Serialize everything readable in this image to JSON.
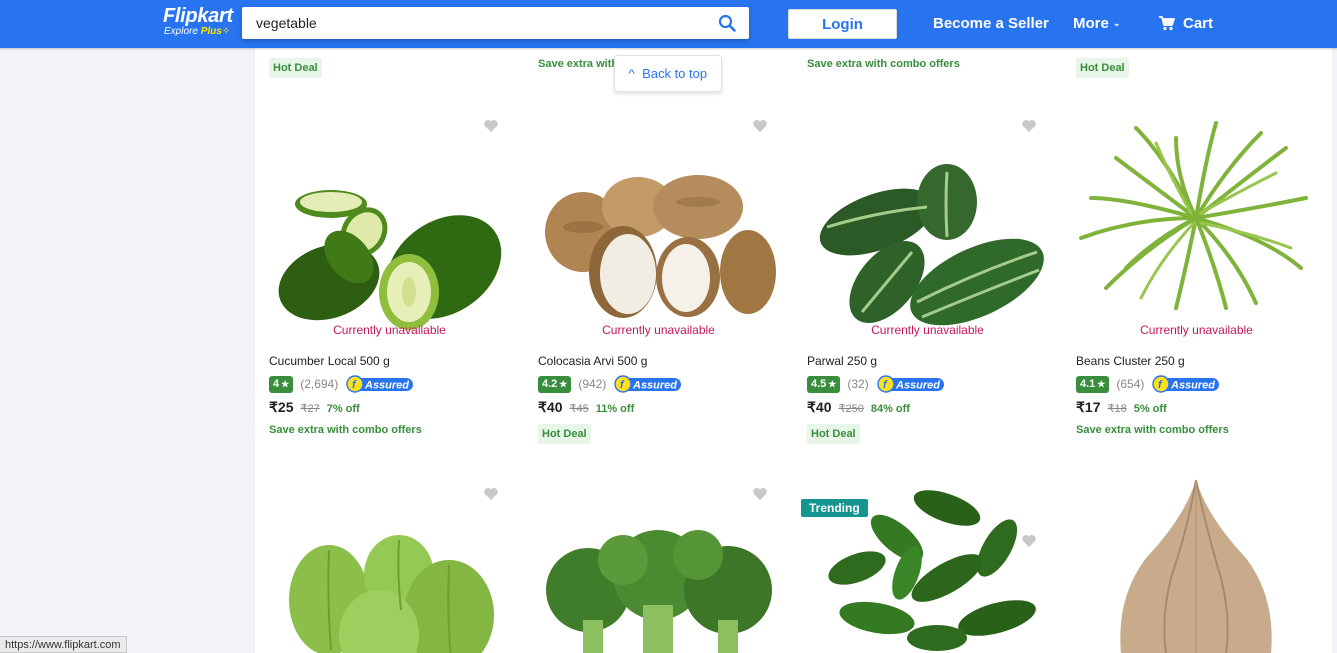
{
  "header": {
    "logo": "Flipkart",
    "logo_sub": "Explore",
    "logo_plus": "Plus",
    "search_value": "vegetable",
    "login_label": "Login",
    "become_seller_label": "Become a Seller",
    "more_label": "More",
    "cart_label": "Cart",
    "brand_color": "#2874f0"
  },
  "back_to_top_label": "Back to top",
  "previous_row": {
    "tags": [
      "Hot Deal",
      "Save extra with",
      "Save extra with combo offers",
      "Hot Deal"
    ]
  },
  "products": [
    {
      "name": "Cucumber Local 500 g",
      "status": "Currently unavailable",
      "rating": "4",
      "reviews": "(2,694)",
      "price": "₹25",
      "mrp": "₹27",
      "discount": "7% off",
      "offer": "Save extra with combo offers",
      "assured": "Assured"
    },
    {
      "name": "Colocasia Arvi 500 g",
      "status": "Currently unavailable",
      "rating": "4.2",
      "reviews": "(942)",
      "price": "₹40",
      "mrp": "₹45",
      "discount": "11% off",
      "offer": "Hot Deal",
      "assured": "Assured"
    },
    {
      "name": "Parwal 250 g",
      "status": "Currently unavailable",
      "rating": "4.5",
      "reviews": "(32)",
      "price": "₹40",
      "mrp": "₹250",
      "discount": "84% off",
      "offer": "Hot Deal",
      "assured": "Assured"
    },
    {
      "name": "Beans Cluster 250 g",
      "status": "Currently unavailable",
      "rating": "4.1",
      "reviews": "(654)",
      "price": "₹17",
      "mrp": "₹18",
      "discount": "5% off",
      "offer": "Save extra with combo offers",
      "assured": "Assured"
    }
  ],
  "next_row": {
    "trending_label": "Trending"
  },
  "status_bar": "https://www.flipkart.com"
}
